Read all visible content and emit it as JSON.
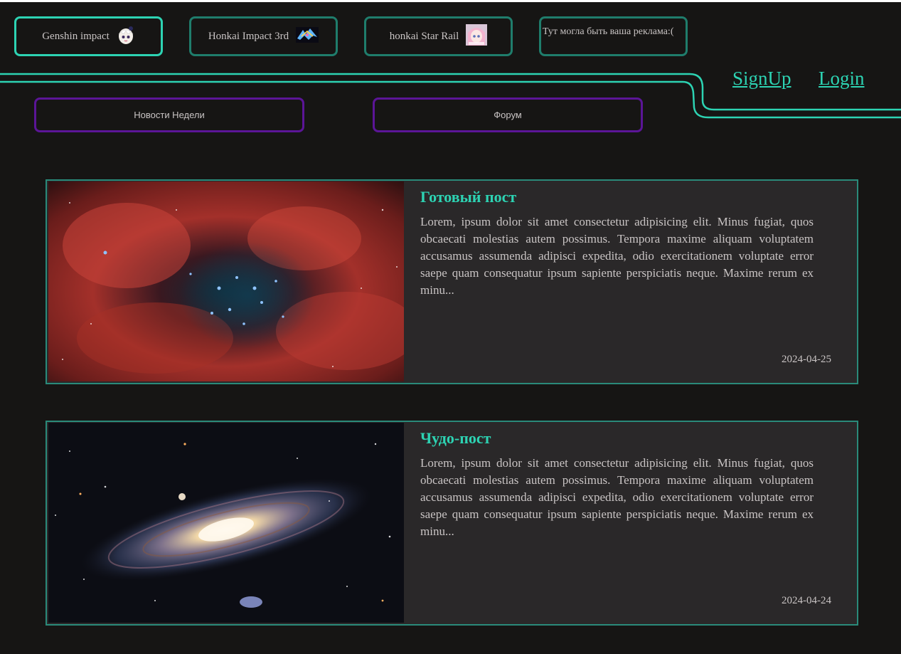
{
  "header": {
    "game_tabs": [
      {
        "label": "Genshin impact",
        "icon": "paimon-avatar-icon",
        "active": true
      },
      {
        "label": "Honkai Impact 3rd",
        "icon": "honkai-logo-icon",
        "active": false
      },
      {
        "label": "honkai Star Rail",
        "icon": "march-seventh-avatar-icon",
        "active": false
      },
      {
        "label": "Тут могла быть ваша реклама:(",
        "icon": "",
        "active": false
      }
    ],
    "auth": {
      "signup_label": "SignUp",
      "login_label": "Login"
    }
  },
  "nav": {
    "weekly_news_label": "Новости Недели",
    "forum_label": "Форум"
  },
  "posts": [
    {
      "title": "Готовый пост",
      "body": "Lorem, ipsum dolor sit amet consectetur adipisicing elit. Minus fugiat, quos obcaecati molestias autem possimus. Tempora maxime aliquam voluptatem accusamus assumenda adipisci expedita, odio exercitationem voluptate error saepe quam consequatur ipsum sapiente perspiciatis neque. Maxime rerum ex minu...",
      "date": "2024-04-25",
      "image": "rosette-nebula-image"
    },
    {
      "title": "Чудо-пост",
      "body": "Lorem, ipsum dolor sit amet consectetur adipisicing elit. Minus fugiat, quos obcaecati molestias autem possimus. Tempora maxime aliquam voluptatem accusamus assumenda adipisci expedita, odio exercitationem voluptate error saepe quam consequatur ipsum sapiente perspiciatis neque. Maxime rerum ex minu...",
      "date": "2024-04-24",
      "image": "andromeda-galaxy-image"
    }
  ],
  "colors": {
    "background": "#161514",
    "accent_teal": "#2dd3b3",
    "tab_border": "#1f7d6c",
    "nav_border": "#5b1597",
    "post_bg": "#2a2829"
  }
}
